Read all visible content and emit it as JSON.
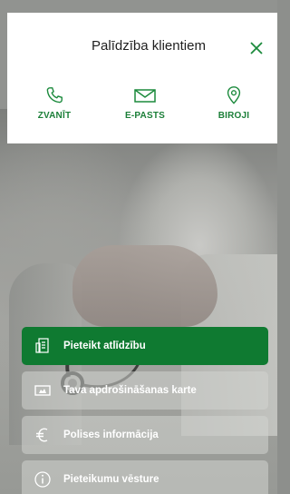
{
  "header": {
    "title": "Palīdzība klientiem",
    "close_icon": "close-icon"
  },
  "contacts": [
    {
      "label": "ZVANĪT",
      "icon": "phone-icon"
    },
    {
      "label": "E-PASTS",
      "icon": "envelope-icon"
    },
    {
      "label": "BIROJI",
      "icon": "location-pin-icon"
    }
  ],
  "menu": [
    {
      "label": "Pieteikt atlīdzību",
      "icon": "claim-document-icon",
      "active": true
    },
    {
      "label": "Tava apdrošināšanas karte",
      "icon": "card-icon",
      "active": false
    },
    {
      "label": "Polises informācija",
      "icon": "euro-icon",
      "active": false
    },
    {
      "label": "Pieteikumu vēsture",
      "icon": "info-icon",
      "active": false
    }
  ],
  "colors": {
    "accent": "#1b8a3c",
    "primary_button": "#0f7a31",
    "header_bg": "#ffffff"
  }
}
